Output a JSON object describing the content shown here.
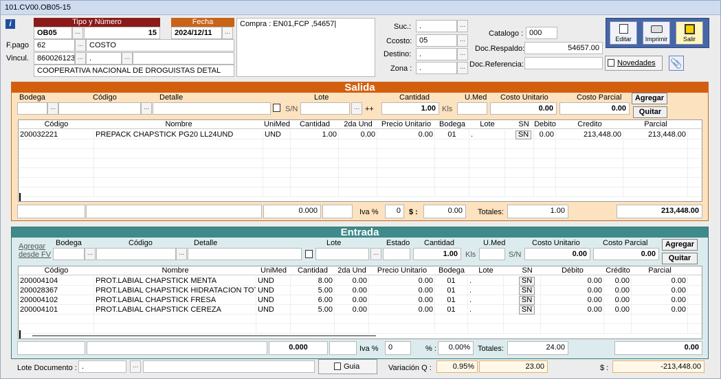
{
  "window": {
    "title": "101.CV00.OB05-15"
  },
  "header": {
    "tipo_numero_label": "Tipo y Número",
    "tipo": "OB05",
    "numero": "15",
    "fecha_label": "Fecha",
    "fecha": "2024/12/11",
    "fpago_label": "F.pago",
    "fpago": "62",
    "fpago_desc": "COSTO",
    "vincul_label": "Vincul.",
    "vincul": "860026123",
    "vincul_extra": ".",
    "vincul_name": "COOPERATIVA NACIONAL DE DROGUISTAS DETAL",
    "observaciones": "Compra : EN01,FCP ,54657|",
    "suc_label": "Suc.:",
    "suc": ".",
    "ccosto_label": "Ccosto:",
    "ccosto": "05",
    "destino_label": "Destino:",
    "destino": ".",
    "zona_label": "Zona :",
    "zona": ".",
    "catalogo_label": "Catalogo :",
    "catalogo": "000",
    "doc_respaldo_label": "Doc.Respaldo:",
    "doc_respaldo": "54657.00",
    "doc_referencia_label": "Doc.Referencia:",
    "doc_referencia": "",
    "novedades_label": "Novedades"
  },
  "toolbar": {
    "editar": "Editar",
    "imprimir": "Imprimir",
    "salir": "Salir"
  },
  "salida": {
    "title": "Salida",
    "labels": {
      "bodega": "Bodega",
      "codigo": "Código",
      "detalle": "Detalle",
      "lote": "Lote",
      "cantidad": "Cantidad",
      "umed": "U.Med",
      "costo_unitario": "Costo Unitario",
      "costo_parcial": "Costo Parcial"
    },
    "sn": "S/N",
    "plus": "++",
    "cantidad": "1.00",
    "kls": "Kls",
    "costo_unitario": "0.00",
    "costo_parcial": "0.00",
    "agregar": "Agregar",
    "quitar": "Quitar",
    "columns": [
      "Código",
      "Nombre",
      "UniMed",
      "Cantidad",
      "2da Und",
      "Precio Unitario",
      "Bodega",
      "Lote",
      "SN",
      "Debito",
      "Credito",
      "Parcial"
    ],
    "rows": [
      [
        "200032221",
        "PREPACK CHAPSTICK PG20 LL24UND",
        "UND",
        "1.00",
        "0.00",
        "0.00",
        "01",
        ".",
        "SN",
        "0.00",
        "213,448.00",
        "213,448.00"
      ]
    ],
    "footer": {
      "qty": "0.000",
      "iva_label": "Iva %",
      "iva": "0",
      "dollar_label": "$ :",
      "dollar": "0.00",
      "totales_label": "Totales:",
      "totales": "1.00",
      "total": "213,448.00"
    }
  },
  "entrada": {
    "title": "Entrada",
    "agregar_fv": "Agregar desde FV",
    "labels": {
      "bodega": "Bodega",
      "codigo": "Código",
      "detalle": "Detalle",
      "lote": "Lote",
      "estado": "Estado",
      "cantidad": "Cantidad",
      "umed": "U.Med",
      "costo_unitario": "Costo Unitario",
      "costo_parcial": "Costo Parcial"
    },
    "cantidad": "1.00",
    "kls": "Kls",
    "sn": "S/N",
    "costo_unitario": "0.00",
    "costo_parcial": "0.00",
    "agregar": "Agregar",
    "quitar": "Quitar",
    "columns": [
      "Código",
      "Nombre",
      "UniMed",
      "Cantidad",
      "2da Und",
      "Precio Unitario",
      "Bodega",
      "Lote",
      "SN",
      "Débito",
      "Crédito",
      "Parcial"
    ],
    "rows": [
      [
        "200004104",
        "PROT.LABIAL CHAPSTICK MENTA",
        "UND",
        "8.00",
        "0.00",
        "0.00",
        "01",
        ".",
        "SN",
        "0.00",
        "0.00",
        "0.00"
      ],
      [
        "200028367",
        "PROT.LABIAL CHAPSTICK HIDRATACION TOTAL",
        "UND",
        "5.00",
        "0.00",
        "0.00",
        "01",
        ".",
        "SN",
        "0.00",
        "0.00",
        "0.00"
      ],
      [
        "200004102",
        "PROT.LABIAL CHAPSTICK FRESA",
        "UND",
        "6.00",
        "0.00",
        "0.00",
        "01",
        ".",
        "SN",
        "0.00",
        "0.00",
        "0.00"
      ],
      [
        "200004101",
        "PROT.LABIAL CHAPSTICK CEREZA",
        "UND",
        "5.00",
        "0.00",
        "0.00",
        "01",
        ".",
        "SN",
        "0.00",
        "0.00",
        "0.00"
      ]
    ],
    "footer": {
      "qty": "0.000",
      "iva_label": "Iva %",
      "iva": "0",
      "pct_label": "% :",
      "pct": "0.00%",
      "totales_label": "Totales:",
      "totales": "24.00",
      "total": "0.00"
    }
  },
  "bottom": {
    "lote_doc_label": "Lote Documento :",
    "lote_doc": ".",
    "guia": "Guia",
    "variacion_label": "Variación Q :",
    "variacion_pct": "0.95%",
    "variacion_val": "23.00",
    "dollar_label": "$ :",
    "dollar": "-213,448.00"
  },
  "colors": {
    "salida": "#d35f0e",
    "entrada": "#3f8a8a",
    "red_hdr": "#8b1a1a"
  }
}
